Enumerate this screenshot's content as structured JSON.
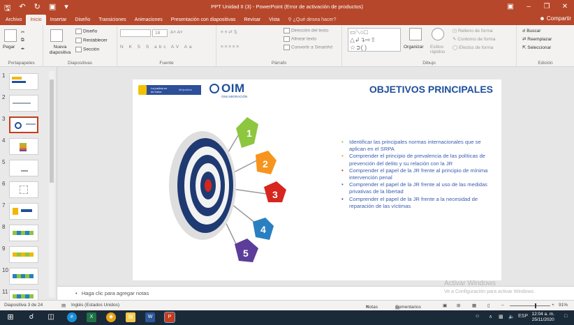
{
  "window": {
    "title": "PPT Unidad II (3) - PowerPoint (Error de activación de productos)"
  },
  "qat": {
    "save_icon": "save-icon",
    "undo_icon": "undo-icon",
    "redo_icon": "redo-icon",
    "present_icon": "present-icon",
    "customize_icon": "customize-icon"
  },
  "tabs": [
    "Archivo",
    "Inicio",
    "Insertar",
    "Diseño",
    "Transiciones",
    "Animaciones",
    "Presentación con diapositivas",
    "Revisar",
    "Vista"
  ],
  "tell_me": "¿Qué desea hacer?",
  "share": "Compartir",
  "ribbon": {
    "clipboard": {
      "paste": "Pegar",
      "label": "Portapapeles"
    },
    "slides": {
      "new_slide": "Nueva diapositiva",
      "layout": "Diseño",
      "reset": "Restablecer",
      "section": "Sección",
      "label": "Diapositivas"
    },
    "font": {
      "size": "18",
      "label": "Fuente",
      "buttons": [
        "N",
        "K",
        "S",
        "S",
        "abc",
        "AV",
        "Aa"
      ]
    },
    "paragraph": {
      "text_direction": "Dirección del texto",
      "align_text": "Alinear texto",
      "smartart": "Convertir a SmartArt",
      "label": "Párrafo"
    },
    "drawing": {
      "arrange": "Organizar",
      "styles": "Estilos rápidos",
      "fill": "Relleno de forma",
      "outline": "Contorno de forma",
      "effects": "Efectos de forma",
      "label": "Dibujo"
    },
    "editing": {
      "find": "Buscar",
      "replace": "Reemplazar",
      "select": "Seleccionar",
      "label": "Edición"
    }
  },
  "thumbnails": [
    "1",
    "2",
    "3",
    "4",
    "5",
    "6",
    "7",
    "8",
    "9",
    "10",
    "11"
  ],
  "slide": {
    "logo_line1": "La justicia es de todos",
    "logo_line2": "Minjusticia",
    "oim": "OIM",
    "oim_sub": "ONU MIGRACIÓN",
    "title": "OBJETIVOS PRINCIPALES",
    "arrow_numbers": [
      "1",
      "2",
      "3",
      "4",
      "5"
    ],
    "colors": {
      "green": "#8dc63f",
      "orange": "#f7941d",
      "red": "#d7261e",
      "blue": "#2a7fc0",
      "purple": "#5c3d99",
      "title_blue": "#1f4e9b"
    },
    "objectives": [
      {
        "text": "Identificar las principales normas internacionales que se aplican en el SRPA",
        "color": "#8dc63f"
      },
      {
        "text": "Comprender el principio de prevalencia de las políticas de prevención del delito y su relación con la JR",
        "color": "#f7941d"
      },
      {
        "text": "Comprender el papel de la JR frente al principio de mínima intervención penal",
        "color": "#d7261e"
      },
      {
        "text": "Comprender el papel de la JR frente al uso de las medidas privativas de la libertad",
        "color": "#2a7fc0"
      },
      {
        "text": "Comprender el papel de la JR frente a la necesidad de reparación de las víctimas",
        "color": "#5c3d99"
      }
    ]
  },
  "notes": "Haga clic para agregar notas",
  "watermark": {
    "line1": "Activar Windows",
    "line2": "Ve a Configuración para activar Windows."
  },
  "status": {
    "slide": "Diapositiva 3 de 24",
    "language": "Inglés (Estados Unidos)",
    "notes": "Notas",
    "comments": "Comentarios",
    "zoom": "91%"
  },
  "taskbar": {
    "lang": "ESP",
    "time": "12:04 a. m.",
    "date": "25/11/2020"
  }
}
